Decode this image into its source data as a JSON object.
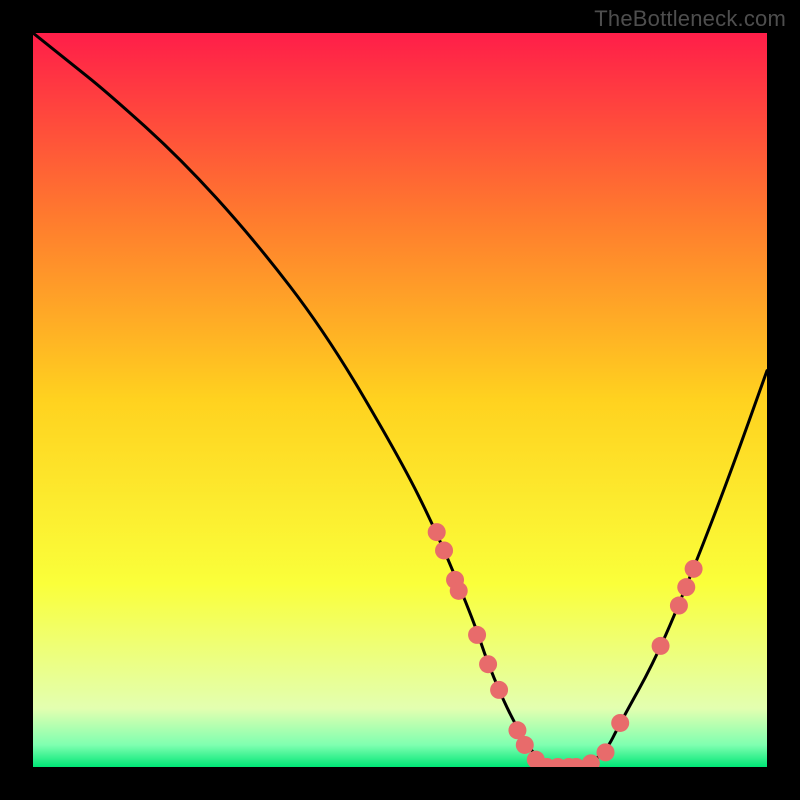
{
  "watermark": "TheBottleneck.com",
  "chart_data": {
    "type": "line",
    "title": "",
    "xlabel": "",
    "ylabel": "",
    "xlim": [
      0,
      100
    ],
    "ylim": [
      0,
      100
    ],
    "gradient_stops": [
      {
        "offset": 0,
        "color": "#ff1e49"
      },
      {
        "offset": 25,
        "color": "#ff7a2e"
      },
      {
        "offset": 50,
        "color": "#ffd21f"
      },
      {
        "offset": 75,
        "color": "#faff3a"
      },
      {
        "offset": 92,
        "color": "#e3ffb0"
      },
      {
        "offset": 97,
        "color": "#7fffb0"
      },
      {
        "offset": 100,
        "color": "#00e676"
      }
    ],
    "series": [
      {
        "name": "bottleneck-curve",
        "x": [
          0,
          5,
          10,
          20,
          30,
          40,
          50,
          55,
          60,
          62,
          65,
          68,
          70,
          72,
          75,
          78,
          80,
          85,
          90,
          95,
          100
        ],
        "y": [
          100,
          96,
          92,
          83,
          72,
          59,
          42,
          32,
          20,
          14,
          7,
          2,
          0,
          0,
          0,
          2,
          6,
          15,
          27,
          40,
          54
        ]
      }
    ],
    "markers": [
      {
        "x": 55.0,
        "y": 32.0
      },
      {
        "x": 56.0,
        "y": 29.5
      },
      {
        "x": 57.5,
        "y": 25.5
      },
      {
        "x": 58.0,
        "y": 24.0
      },
      {
        "x": 60.5,
        "y": 18.0
      },
      {
        "x": 62.0,
        "y": 14.0
      },
      {
        "x": 63.5,
        "y": 10.5
      },
      {
        "x": 66.0,
        "y": 5.0
      },
      {
        "x": 67.0,
        "y": 3.0
      },
      {
        "x": 68.5,
        "y": 1.0
      },
      {
        "x": 70.0,
        "y": 0.0
      },
      {
        "x": 71.5,
        "y": 0.0
      },
      {
        "x": 73.0,
        "y": 0.0
      },
      {
        "x": 74.0,
        "y": 0.0
      },
      {
        "x": 76.0,
        "y": 0.5
      },
      {
        "x": 78.0,
        "y": 2.0
      },
      {
        "x": 80.0,
        "y": 6.0
      },
      {
        "x": 85.5,
        "y": 16.5
      },
      {
        "x": 88.0,
        "y": 22.0
      },
      {
        "x": 89.0,
        "y": 24.5
      },
      {
        "x": 90.0,
        "y": 27.0
      }
    ],
    "marker_color": "#e86b6b",
    "marker_radius": 9
  }
}
